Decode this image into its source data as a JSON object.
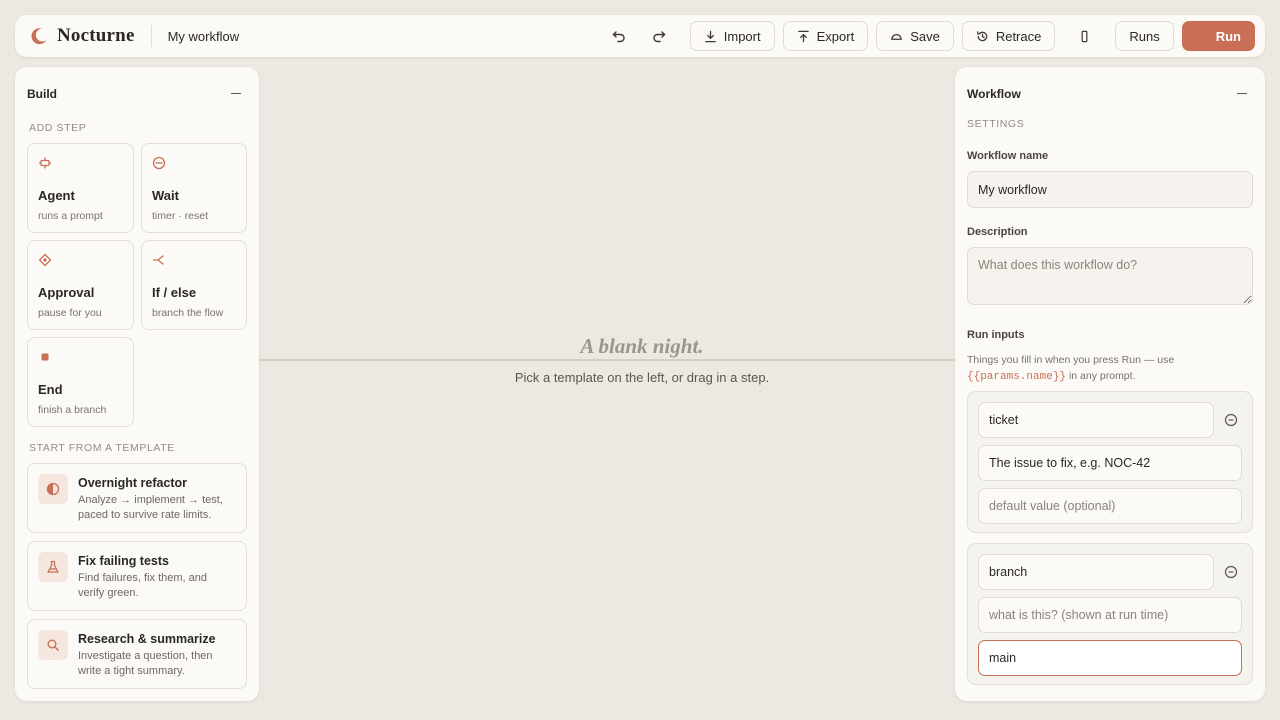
{
  "app": {
    "name": "Nocturne",
    "workflow_title": "My workflow"
  },
  "toolbar": {
    "import": "Import",
    "export": "Export",
    "save": "Save",
    "retrace": "Retrace",
    "runs": "Runs",
    "run": "Run"
  },
  "build": {
    "title": "Build",
    "add_step_label": "ADD STEP",
    "steps": [
      {
        "title": "Agent",
        "sub": "runs a prompt",
        "icon": "agent-icon"
      },
      {
        "title": "Wait",
        "sub": "timer · reset",
        "icon": "wait-icon"
      },
      {
        "title": "Approval",
        "sub": "pause for you",
        "icon": "approval-icon"
      },
      {
        "title": "If / else",
        "sub": "branch the flow",
        "icon": "branch-icon"
      },
      {
        "title": "End",
        "sub": "finish a branch",
        "icon": "end-icon"
      }
    ],
    "templates_label": "START FROM A TEMPLATE",
    "templates": [
      {
        "title": "Overnight refactor",
        "desc": "Analyze → implement → test, paced to survive rate limits.",
        "icon": "half-moon-icon"
      },
      {
        "title": "Fix failing tests",
        "desc": "Find failures, fix them, and verify green.",
        "icon": "flask-icon"
      },
      {
        "title": "Research & summarize",
        "desc": "Investigate a question, then write a tight summary.",
        "icon": "search-icon"
      }
    ]
  },
  "canvas": {
    "title": "A blank night.",
    "subtitle": "Pick a template on the left, or drag in a step."
  },
  "workflow": {
    "title": "Workflow",
    "settings_label": "SETTINGS",
    "name_label": "Workflow name",
    "name_value": "My workflow",
    "description_label": "Description",
    "description_placeholder": "What does this workflow do?",
    "run_inputs_label": "Run inputs",
    "run_inputs_help_1": "Things you fill in when you press Run — use",
    "run_inputs_help_code": "{{params.name}}",
    "run_inputs_help_2": "in any prompt.",
    "params": [
      {
        "name": "ticket",
        "description": "The issue to fix, e.g. NOC-42",
        "description_placeholder": "what is this? (shown at run time)",
        "default": "",
        "default_placeholder": "default value (optional)"
      },
      {
        "name": "branch",
        "description": "",
        "description_placeholder": "what is this? (shown at run time)",
        "default": "main",
        "default_placeholder": "default value (optional)"
      }
    ]
  },
  "colors": {
    "accent": "#c96f55",
    "background": "#ece9e2",
    "panel": "#fbfaf7"
  }
}
